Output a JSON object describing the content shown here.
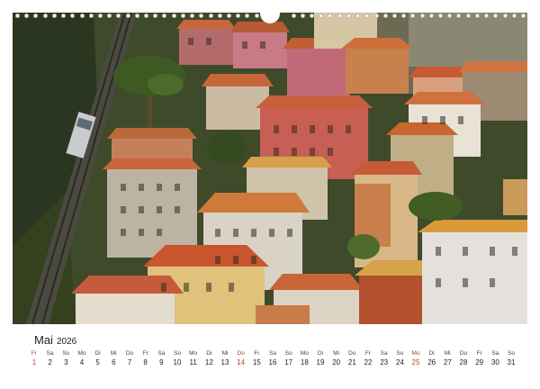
{
  "calendar": {
    "month": "Mai",
    "year": "2026",
    "days": [
      {
        "wd": "Fr",
        "dn": "1",
        "red": true
      },
      {
        "wd": "Sa",
        "dn": "2",
        "red": false
      },
      {
        "wd": "So",
        "dn": "3",
        "red": false
      },
      {
        "wd": "Mo",
        "dn": "4",
        "red": false
      },
      {
        "wd": "Di",
        "dn": "5",
        "red": false
      },
      {
        "wd": "Mi",
        "dn": "6",
        "red": false
      },
      {
        "wd": "Do",
        "dn": "7",
        "red": false
      },
      {
        "wd": "Fr",
        "dn": "8",
        "red": false
      },
      {
        "wd": "Sa",
        "dn": "9",
        "red": false
      },
      {
        "wd": "So",
        "dn": "10",
        "red": false
      },
      {
        "wd": "Mo",
        "dn": "11",
        "red": false
      },
      {
        "wd": "Di",
        "dn": "12",
        "red": false
      },
      {
        "wd": "Mi",
        "dn": "13",
        "red": false
      },
      {
        "wd": "Do",
        "dn": "14",
        "red": true
      },
      {
        "wd": "Fr",
        "dn": "15",
        "red": false
      },
      {
        "wd": "Sa",
        "dn": "16",
        "red": false
      },
      {
        "wd": "So",
        "dn": "17",
        "red": false
      },
      {
        "wd": "Mo",
        "dn": "18",
        "red": false
      },
      {
        "wd": "Di",
        "dn": "19",
        "red": false
      },
      {
        "wd": "Mi",
        "dn": "20",
        "red": false
      },
      {
        "wd": "Do",
        "dn": "21",
        "red": false
      },
      {
        "wd": "Fr",
        "dn": "22",
        "red": false
      },
      {
        "wd": "Sa",
        "dn": "23",
        "red": false
      },
      {
        "wd": "So",
        "dn": "24",
        "red": false
      },
      {
        "wd": "Mo",
        "dn": "25",
        "red": true
      },
      {
        "wd": "Di",
        "dn": "26",
        "red": false
      },
      {
        "wd": "Mi",
        "dn": "27",
        "red": false
      },
      {
        "wd": "Do",
        "dn": "28",
        "red": false
      },
      {
        "wd": "Fr",
        "dn": "29",
        "red": false
      },
      {
        "wd": "Sa",
        "dn": "30",
        "red": false
      },
      {
        "wd": "So",
        "dn": "31",
        "red": false
      }
    ]
  },
  "colors": {
    "holiday": "#c0392b",
    "roof": "#c8663a",
    "hillside": "#3d4a26",
    "sky_wall": "#e0d4bc"
  }
}
